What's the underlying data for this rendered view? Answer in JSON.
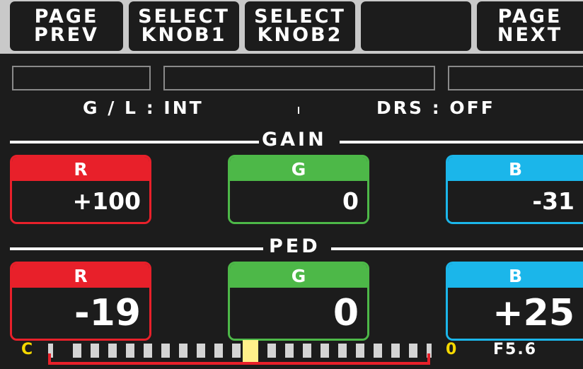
{
  "softkeys": [
    {
      "line1": "PAGE",
      "line2": "PREV"
    },
    {
      "line1": "SELECT",
      "line2": "KNOB1"
    },
    {
      "line1": "SELECT",
      "line2": "KNOB2"
    },
    {
      "line1": "",
      "line2": ""
    },
    {
      "line1": "PAGE",
      "line2": "NEXT"
    }
  ],
  "info": {
    "gl": "G / L : INT",
    "drs": "DRS : OFF"
  },
  "gain": {
    "title": "GAIN",
    "r": {
      "label": "R",
      "value": "+100"
    },
    "g": {
      "label": "G",
      "value": "0"
    },
    "b": {
      "label": "B",
      "value": "-31"
    }
  },
  "ped": {
    "title": "PED",
    "r": {
      "label": "R",
      "value": "-19"
    },
    "g": {
      "label": "G",
      "value": "0"
    },
    "b": {
      "label": "B",
      "value": "+25"
    }
  },
  "meter": {
    "left_label": "C",
    "right_label": "0",
    "f_stop": "F5.6"
  },
  "colors": {
    "red": "#e8202a",
    "green": "#4db848",
    "blue": "#1bb6ea",
    "meter_label": "#f5d800",
    "cursor": "#fff08a"
  }
}
